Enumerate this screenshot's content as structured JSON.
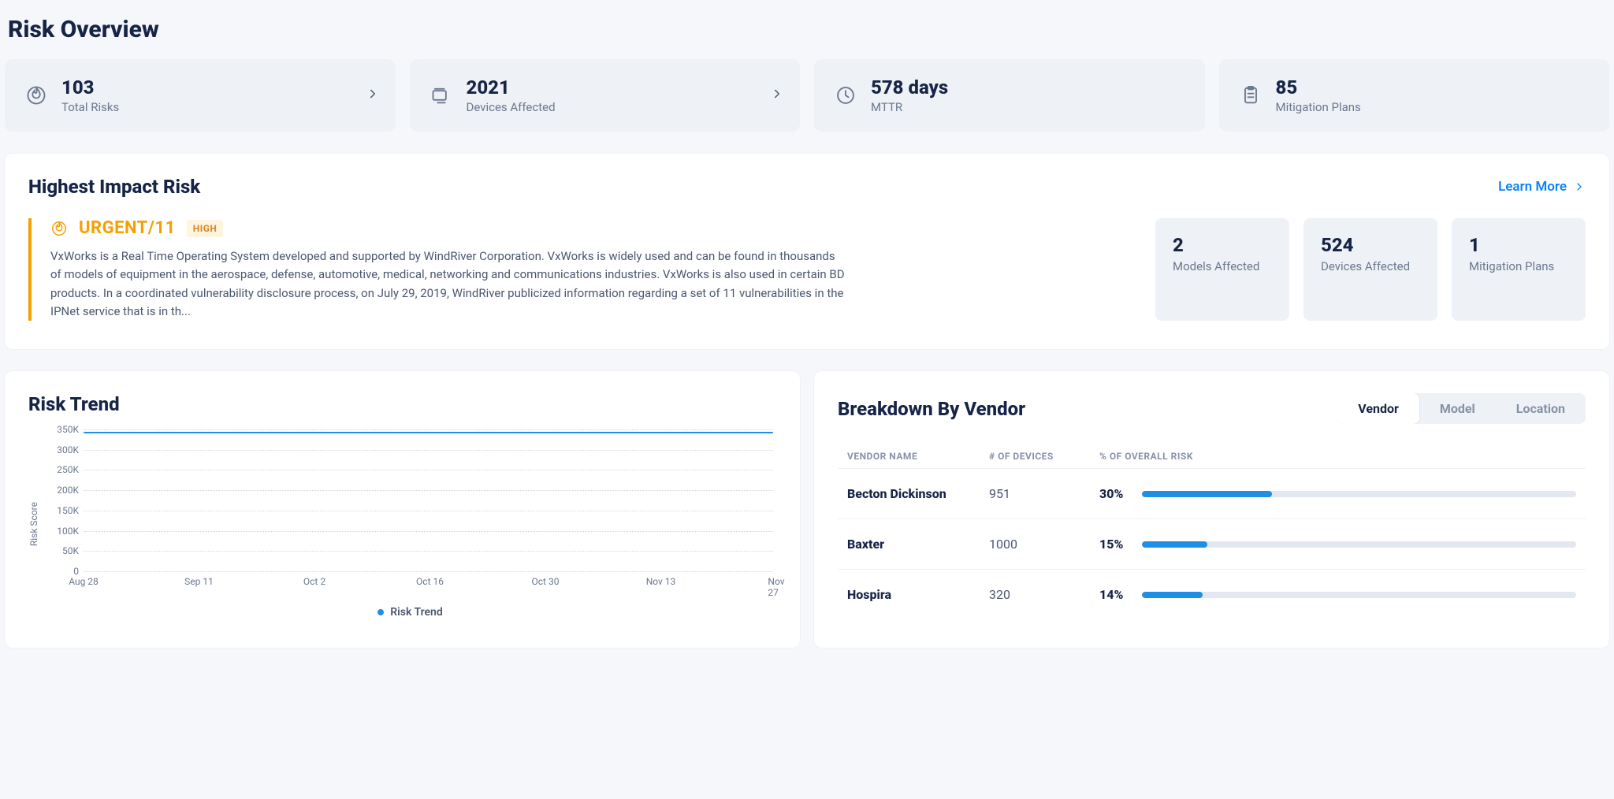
{
  "page_title": "Risk Overview",
  "stats": [
    {
      "value": "103",
      "label": "Total Risks",
      "icon": "fire",
      "chevron": true
    },
    {
      "value": "2021",
      "label": "Devices Affected",
      "icon": "devices",
      "chevron": true
    },
    {
      "value": "578 days",
      "label": "MTTR",
      "icon": "clock",
      "chevron": false
    },
    {
      "value": "85",
      "label": "Mitigation Plans",
      "icon": "clipboard",
      "chevron": false
    }
  ],
  "highest_impact": {
    "section_title": "Highest Impact Risk",
    "learn_more": "Learn More",
    "name": "URGENT/11",
    "severity": "HIGH",
    "description": "VxWorks is a Real Time Operating System developed and supported by WindRiver Corporation. VxWorks is widely used and can be found in thousands of models of equipment in the aerospace, defense, automotive, medical, networking and communications industries. VxWorks is also used in certain BD products. In a coordinated vulnerability disclosure process, on July 29, 2019, WindRiver publicized information regarding a set of 11 vulnerabilities in the IPNet service that is in th...",
    "metrics": [
      {
        "value": "2",
        "label": "Models Affected"
      },
      {
        "value": "524",
        "label": "Devices Affected"
      },
      {
        "value": "1",
        "label": "Mitigation Plans"
      }
    ]
  },
  "risk_trend": {
    "title": "Risk Trend",
    "ylabel": "Risk Score",
    "legend": "Risk Trend"
  },
  "chart_data": {
    "type": "line",
    "xlabel": "",
    "ylabel": "Risk Score",
    "ylim": [
      0,
      350000
    ],
    "yticks": [
      0,
      50000,
      100000,
      150000,
      200000,
      250000,
      300000,
      350000
    ],
    "ytick_labels": [
      "0",
      "50K",
      "100K",
      "150K",
      "200K",
      "250K",
      "300K",
      "350K"
    ],
    "x_categories": [
      "Aug 28",
      "Sep 11",
      "Oct 2",
      "Oct 16",
      "Oct 30",
      "Nov 13",
      "Nov 27"
    ],
    "series": [
      {
        "name": "Risk Trend",
        "values": [
          345000,
          342000,
          342000,
          342000,
          342000,
          342000,
          342000
        ]
      }
    ]
  },
  "breakdown": {
    "title": "Breakdown By Vendor",
    "tabs": [
      "Vendor",
      "Model",
      "Location"
    ],
    "active_tab": "Vendor",
    "columns": [
      "VENDOR NAME",
      "# OF DEVICES",
      "% OF OVERALL RISK"
    ],
    "rows": [
      {
        "name": "Becton Dickinson",
        "devices": "951",
        "pct": 30
      },
      {
        "name": "Baxter",
        "devices": "1000",
        "pct": 15
      },
      {
        "name": "Hospira",
        "devices": "320",
        "pct": 14
      }
    ]
  }
}
